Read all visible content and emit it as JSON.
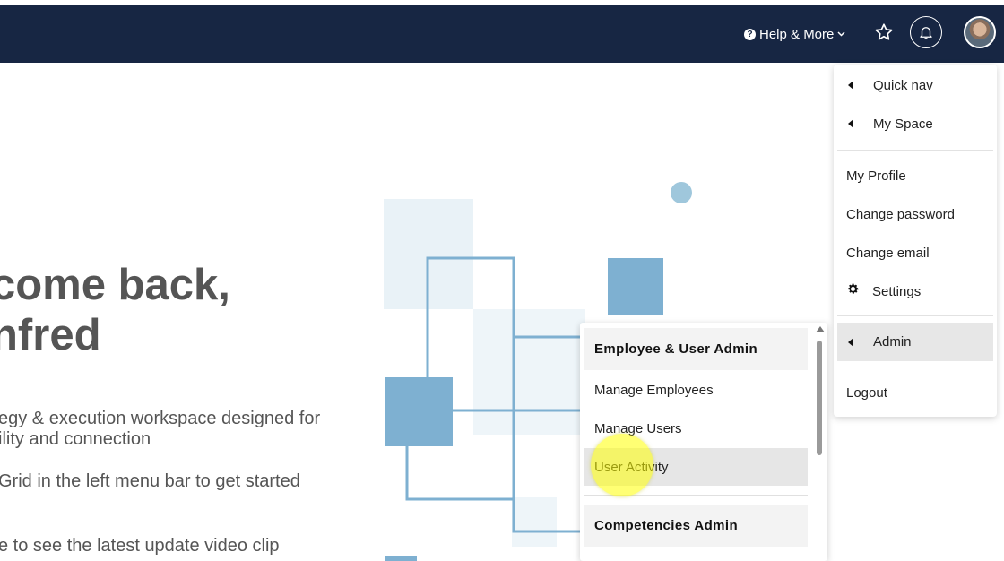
{
  "header": {
    "help_label": "Help & More",
    "icons": [
      "question-circle-icon",
      "chevron-down-icon",
      "star-icon",
      "bell-icon",
      "user-avatar"
    ]
  },
  "hero": {
    "title_line1": "come back,",
    "title_line2": "nfred",
    "text_line1": "egy & execution workspace designed for",
    "text_line2": "ility and connection",
    "text_line3": "Grid in the left menu bar to get started",
    "text_line4": "e to see the latest update video clip"
  },
  "user_menu": {
    "quick_nav": "Quick nav",
    "my_space": "My Space",
    "my_profile": "My Profile",
    "change_password": "Change password",
    "change_email": "Change email",
    "settings": "Settings",
    "admin": "Admin",
    "logout": "Logout"
  },
  "admin_menu": {
    "section1": "Employee & User Admin",
    "manage_employees": "Manage Employees",
    "manage_users": "Manage Users",
    "user_activity": "User Activity",
    "section2": "Competencies Admin"
  },
  "colors": {
    "topbar": "#172643",
    "accent_blue": "#7eb0d1",
    "highlight": "#ffff00"
  }
}
